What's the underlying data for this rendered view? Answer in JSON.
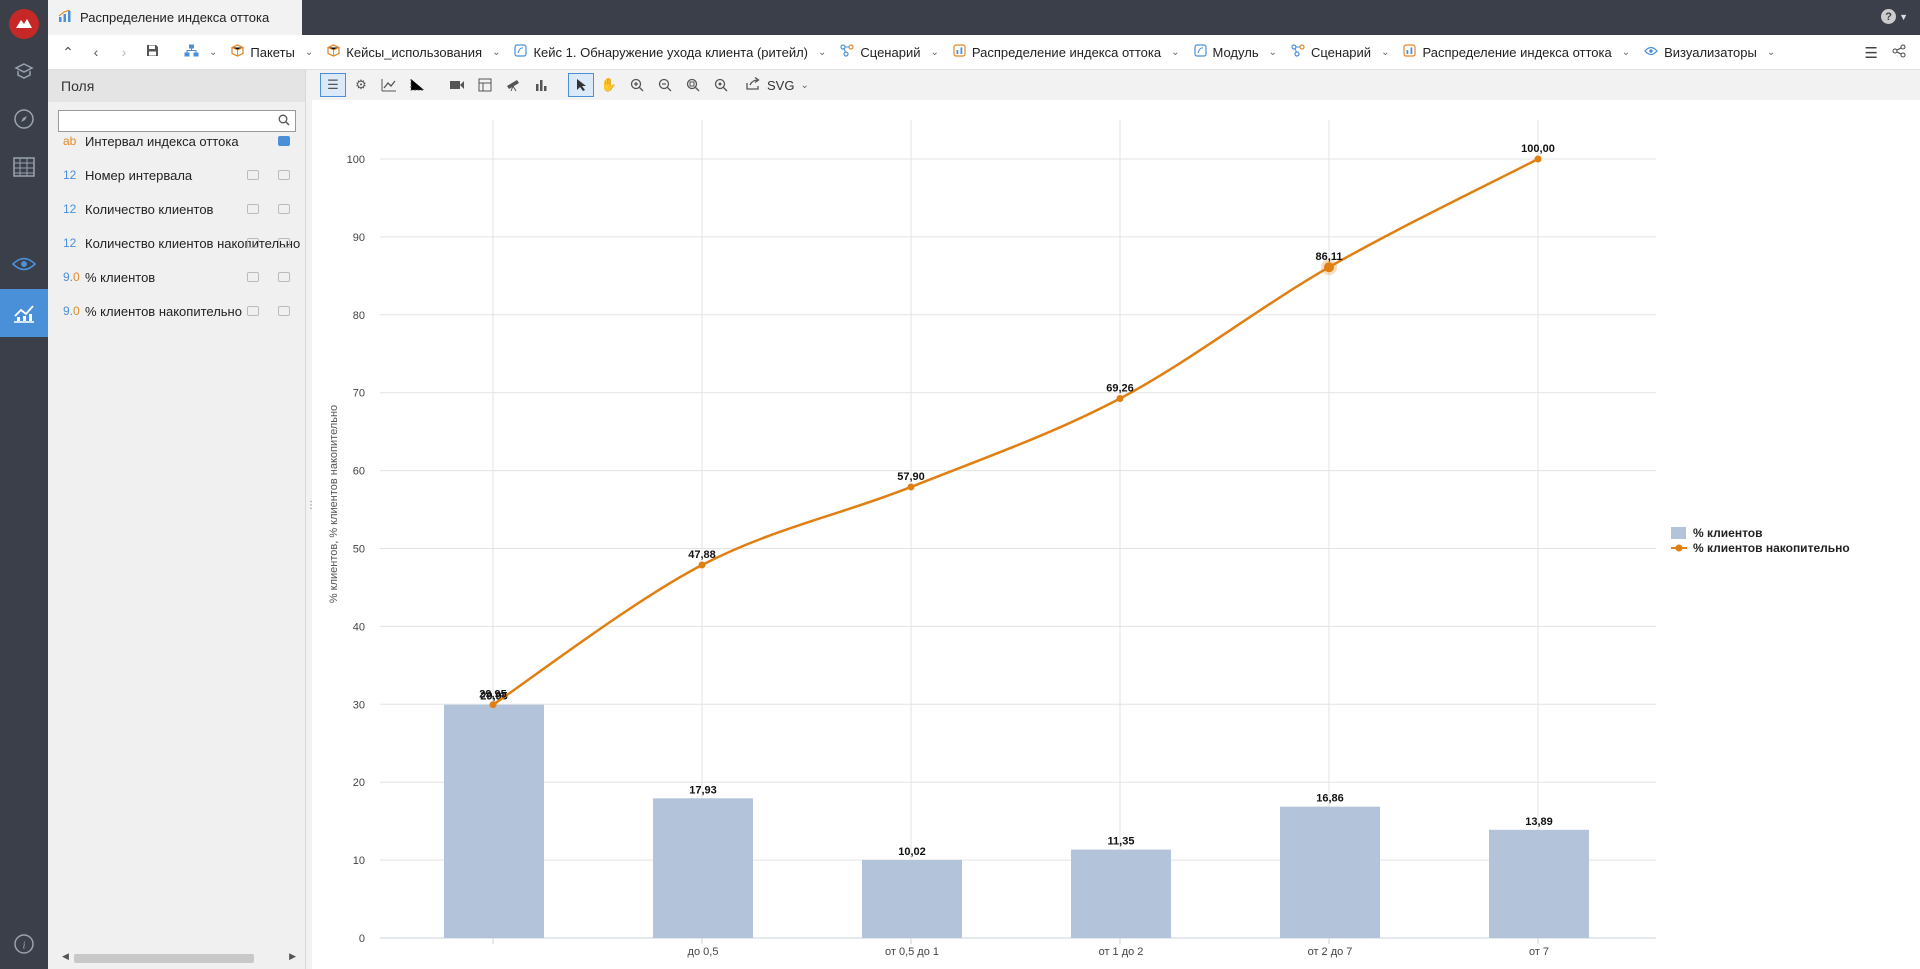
{
  "window": {
    "tab_title": "Распределение индекса оттока",
    "help_label": "?"
  },
  "breadcrumbs": [
    {
      "label": "Пакеты",
      "icon": "package-icon"
    },
    {
      "label": "Кейсы_использования",
      "icon": "package-icon"
    },
    {
      "label": "Кейс 1. Обнаружение ухода клиента (ритейл)",
      "icon": "module-icon"
    },
    {
      "label": "Сценарий",
      "icon": "scenario-icon"
    },
    {
      "label": "Распределение индекса оттока",
      "icon": "node-icon"
    },
    {
      "label": "Модуль",
      "icon": "module-icon"
    },
    {
      "label": "Сценарий",
      "icon": "scenario-icon"
    },
    {
      "label": "Распределение индекса оттока",
      "icon": "node-icon"
    },
    {
      "label": "Визуализаторы",
      "icon": "eye-icon"
    }
  ],
  "fields_panel": {
    "title": "Поля",
    "search_placeholder": "",
    "fields": [
      {
        "type": "ab",
        "name": "Интервал индекса оттока"
      },
      {
        "type": "12",
        "name": "Номер интервала"
      },
      {
        "type": "12",
        "name": "Количество клиентов"
      },
      {
        "type": "12",
        "name": "Количество клиентов накопительно"
      },
      {
        "type": "9.0",
        "name": "% клиентов"
      },
      {
        "type": "9.0",
        "name": "% клиентов накопительно"
      }
    ]
  },
  "toolbar": {
    "export_label": "SVG"
  },
  "colors": {
    "bar": "#b3c4da",
    "line": "#e07f12",
    "accent": "#4a90d9"
  },
  "chart_data": {
    "type": "bar",
    "categories": [
      "",
      "до 0,5",
      "от 0,5 до 1",
      "от 1 до 2",
      "от 2 до 7",
      "от 7"
    ],
    "ylabel": "% клиентов, % клиентов накопительно",
    "xlabel": "",
    "ylim": [
      0,
      100
    ],
    "yticks": [
      0,
      10,
      20,
      30,
      40,
      50,
      60,
      70,
      80,
      90,
      100
    ],
    "grid": true,
    "legend_position": "right",
    "series": [
      {
        "name": "% клиентов",
        "type": "bar",
        "values": [
          29.95,
          17.93,
          10.02,
          11.35,
          16.86,
          13.89
        ],
        "labels": [
          "29,95",
          "17,93",
          "10,02",
          "11,35",
          "16,86",
          "13,89"
        ]
      },
      {
        "name": "% клиентов накопительно",
        "type": "line",
        "values": [
          29.95,
          47.88,
          57.9,
          69.26,
          86.11,
          100.0
        ],
        "labels": [
          "29,95",
          "47,88",
          "57,90",
          "69,26",
          "86,11",
          "100,00"
        ]
      }
    ]
  }
}
